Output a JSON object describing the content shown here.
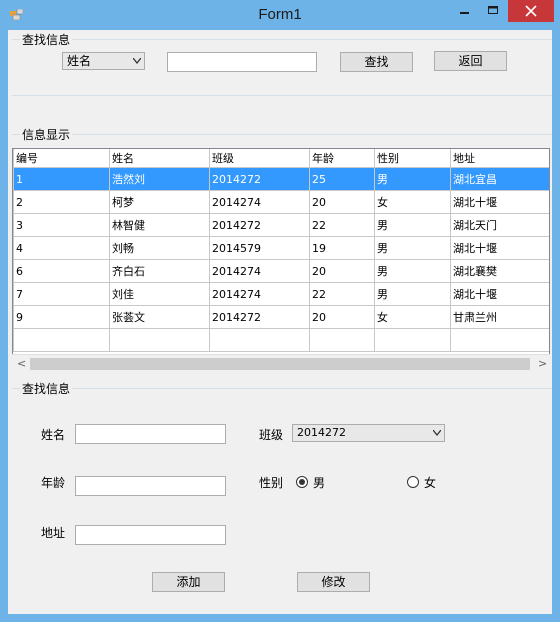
{
  "window": {
    "title": "Form1"
  },
  "search": {
    "group_title": "查找信息",
    "field_select": "姓名",
    "query_value": "",
    "search_label": "查找",
    "back_label": "返回"
  },
  "display": {
    "group_title": "信息显示",
    "columns": [
      "编号",
      "姓名",
      "班级",
      "年龄",
      "性别",
      "地址"
    ],
    "rows": [
      [
        "1",
        "浩然刘",
        "2014272",
        "25",
        "男",
        "湖北宜昌"
      ],
      [
        "2",
        "柯梦",
        "2014274",
        "20",
        "女",
        "湖北十堰"
      ],
      [
        "3",
        "林智健",
        "2014272",
        "22",
        "男",
        "湖北天门"
      ],
      [
        "4",
        "刘畅",
        "2014579",
        "19",
        "男",
        "湖北十堰"
      ],
      [
        "6",
        "齐白石",
        "2014274",
        "20",
        "男",
        "湖北襄樊"
      ],
      [
        "7",
        "刘佳",
        "2014274",
        "22",
        "男",
        "湖北十堰"
      ],
      [
        "9",
        "张荟文",
        "2014272",
        "20",
        "女",
        "甘肃兰州"
      ]
    ],
    "selected_row": 0
  },
  "edit": {
    "group_title": "查找信息",
    "name_label": "姓名",
    "name_value": "",
    "class_label": "班级",
    "class_value": "2014272",
    "age_label": "年龄",
    "age_value": "",
    "gender_label": "性别",
    "gender_male": "男",
    "gender_female": "女",
    "gender_selected": "男",
    "address_label": "地址",
    "address_value": "",
    "add_label": "添加",
    "modify_label": "修改"
  }
}
